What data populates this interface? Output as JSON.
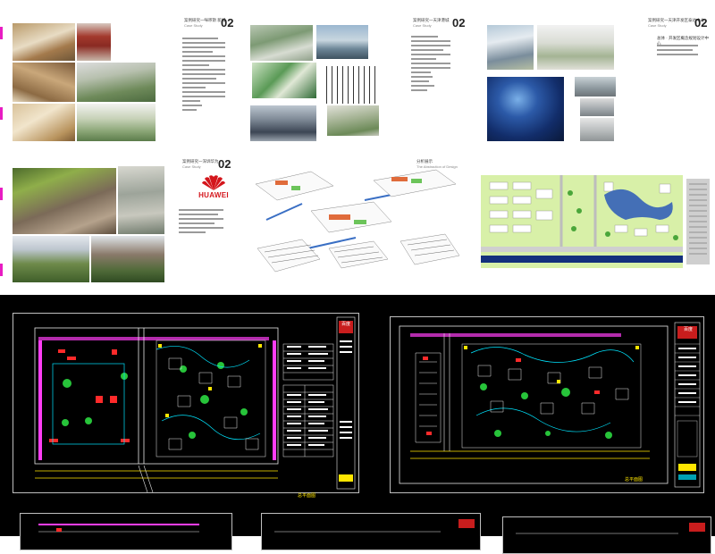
{
  "spreads": [
    {
      "header_zh": "案例研究一咪啰斯 新城",
      "header_en": "Case Study",
      "number": "02"
    },
    {
      "header_zh": "案例研究一天津港城",
      "header_en": "Case Study",
      "number": "02"
    },
    {
      "header_zh": "案例研究一天津开发区泰达中心",
      "header_en": "Case Study",
      "number": "02"
    },
    {
      "header_zh": "案例研究一深圳华为",
      "header_en": "Case Study",
      "number": "02"
    },
    {
      "header_zh": "分析展示",
      "header_en": "The Abstraction of Design",
      "number": ""
    }
  ],
  "huawei_logo": "HUAWEI",
  "page3_title": "总体 · 开发区概念规划设计中心",
  "cad_drawing_1": {
    "badge": "百度",
    "title": "总平面图"
  },
  "cad_drawing_2": {
    "badge": "百度",
    "title": "总平面图"
  },
  "colors": {
    "magenta_edge": "#e81cc2",
    "cad_background": "#000000",
    "cad_road": "#e8e8e8",
    "cad_building": "#ff2a2a",
    "cad_green": "#27c43a",
    "cad_yellow": "#ffe600",
    "cad_cyan": "#00e5ff",
    "cad_magenta": "#ff3df5"
  }
}
